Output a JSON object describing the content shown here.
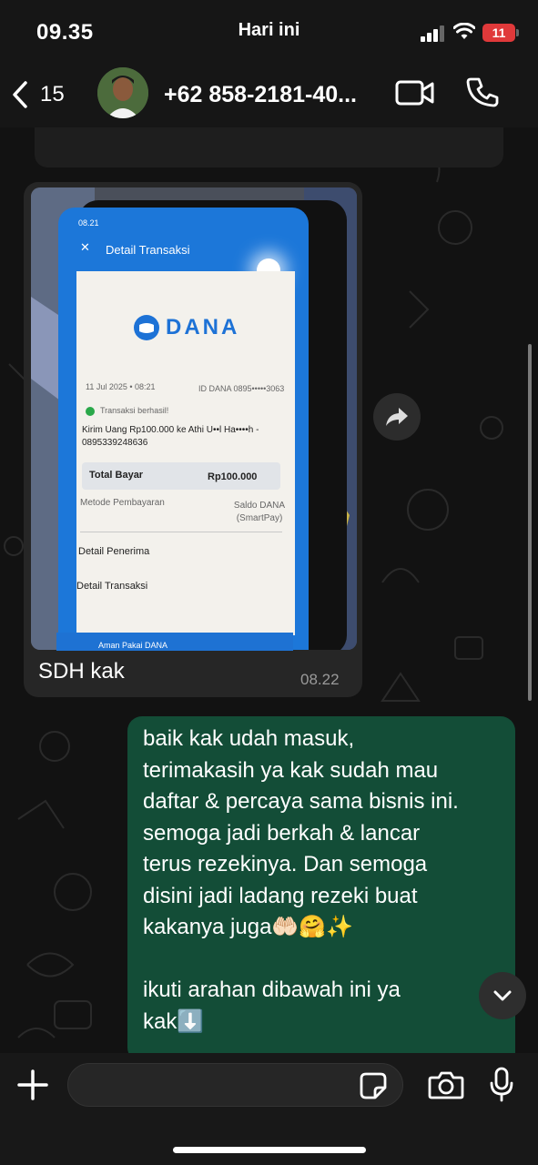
{
  "status_bar": {
    "time": "09.35",
    "battery": "11"
  },
  "header": {
    "back_count": "15",
    "contact": "+62 858-2181-40..."
  },
  "date_divider": "Hari ini",
  "incoming": {
    "caption": "SDH kak",
    "time": "08.22",
    "photo": {
      "phone_time": "08.21",
      "screen_title": "Detail Transaksi",
      "logo": "DANA",
      "date": "11 Jul 2025 • 08:21",
      "id_dana": "ID DANA 0895•••••3063",
      "status": "Transaksi berhasil!",
      "description": "Kirim Uang Rp100.000 ke Athi U••l Ha••••h - 0895339248636",
      "total_label": "Total Bayar",
      "total_value": "Rp100.000",
      "method_label": "Metode Pembayaran",
      "method_value": "Saldo DANA (SmartPay)",
      "recipient_label": "Detail Penerima",
      "transaction_label": "Detail Transaksi",
      "promo": "Aman Pakai DANA"
    }
  },
  "outgoing": {
    "text": "baik kak udah masuk,\nterimakasih ya kak sudah mau\ndaftar & percaya sama bisnis ini.\nsemoga jadi berkah & lancar\nterus rezekinya. Dan semoga\ndisini jadi ladang rezeki buat\nkakanya juga🤲🏻🤗✨\n\nikuti arahan dibawah ini ya\nkak⬇️"
  },
  "composer": {
    "placeholder": ""
  },
  "colors": {
    "outgoing_bubble": "#134d37",
    "incoming_bubble": "#262626",
    "battery": "#e0393a",
    "dana_blue": "#1d72d6"
  }
}
